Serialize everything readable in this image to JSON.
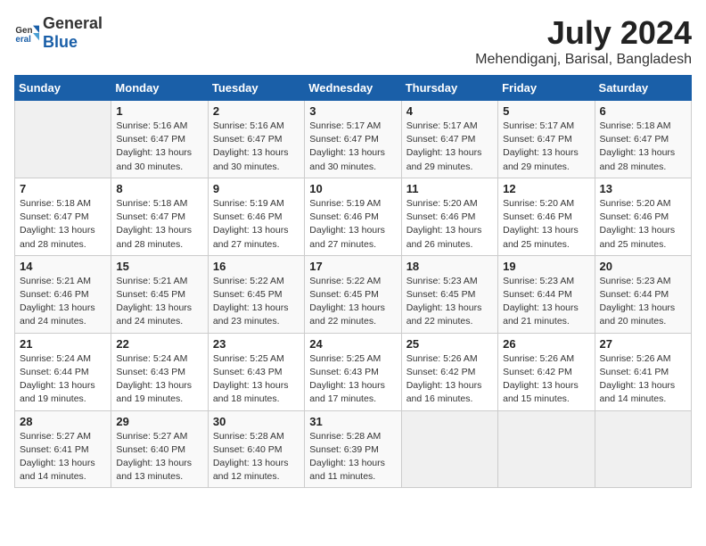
{
  "header": {
    "logo_general": "General",
    "logo_blue": "Blue",
    "title": "July 2024",
    "subtitle": "Mehendiganj, Barisal, Bangladesh"
  },
  "days_of_week": [
    "Sunday",
    "Monday",
    "Tuesday",
    "Wednesday",
    "Thursday",
    "Friday",
    "Saturday"
  ],
  "weeks": [
    [
      {
        "day": "",
        "info": ""
      },
      {
        "day": "1",
        "info": "Sunrise: 5:16 AM\nSunset: 6:47 PM\nDaylight: 13 hours\nand 30 minutes."
      },
      {
        "day": "2",
        "info": "Sunrise: 5:16 AM\nSunset: 6:47 PM\nDaylight: 13 hours\nand 30 minutes."
      },
      {
        "day": "3",
        "info": "Sunrise: 5:17 AM\nSunset: 6:47 PM\nDaylight: 13 hours\nand 30 minutes."
      },
      {
        "day": "4",
        "info": "Sunrise: 5:17 AM\nSunset: 6:47 PM\nDaylight: 13 hours\nand 29 minutes."
      },
      {
        "day": "5",
        "info": "Sunrise: 5:17 AM\nSunset: 6:47 PM\nDaylight: 13 hours\nand 29 minutes."
      },
      {
        "day": "6",
        "info": "Sunrise: 5:18 AM\nSunset: 6:47 PM\nDaylight: 13 hours\nand 28 minutes."
      }
    ],
    [
      {
        "day": "7",
        "info": "Sunrise: 5:18 AM\nSunset: 6:47 PM\nDaylight: 13 hours\nand 28 minutes."
      },
      {
        "day": "8",
        "info": "Sunrise: 5:18 AM\nSunset: 6:47 PM\nDaylight: 13 hours\nand 28 minutes."
      },
      {
        "day": "9",
        "info": "Sunrise: 5:19 AM\nSunset: 6:46 PM\nDaylight: 13 hours\nand 27 minutes."
      },
      {
        "day": "10",
        "info": "Sunrise: 5:19 AM\nSunset: 6:46 PM\nDaylight: 13 hours\nand 27 minutes."
      },
      {
        "day": "11",
        "info": "Sunrise: 5:20 AM\nSunset: 6:46 PM\nDaylight: 13 hours\nand 26 minutes."
      },
      {
        "day": "12",
        "info": "Sunrise: 5:20 AM\nSunset: 6:46 PM\nDaylight: 13 hours\nand 25 minutes."
      },
      {
        "day": "13",
        "info": "Sunrise: 5:20 AM\nSunset: 6:46 PM\nDaylight: 13 hours\nand 25 minutes."
      }
    ],
    [
      {
        "day": "14",
        "info": "Sunrise: 5:21 AM\nSunset: 6:46 PM\nDaylight: 13 hours\nand 24 minutes."
      },
      {
        "day": "15",
        "info": "Sunrise: 5:21 AM\nSunset: 6:45 PM\nDaylight: 13 hours\nand 24 minutes."
      },
      {
        "day": "16",
        "info": "Sunrise: 5:22 AM\nSunset: 6:45 PM\nDaylight: 13 hours\nand 23 minutes."
      },
      {
        "day": "17",
        "info": "Sunrise: 5:22 AM\nSunset: 6:45 PM\nDaylight: 13 hours\nand 22 minutes."
      },
      {
        "day": "18",
        "info": "Sunrise: 5:23 AM\nSunset: 6:45 PM\nDaylight: 13 hours\nand 22 minutes."
      },
      {
        "day": "19",
        "info": "Sunrise: 5:23 AM\nSunset: 6:44 PM\nDaylight: 13 hours\nand 21 minutes."
      },
      {
        "day": "20",
        "info": "Sunrise: 5:23 AM\nSunset: 6:44 PM\nDaylight: 13 hours\nand 20 minutes."
      }
    ],
    [
      {
        "day": "21",
        "info": "Sunrise: 5:24 AM\nSunset: 6:44 PM\nDaylight: 13 hours\nand 19 minutes."
      },
      {
        "day": "22",
        "info": "Sunrise: 5:24 AM\nSunset: 6:43 PM\nDaylight: 13 hours\nand 19 minutes."
      },
      {
        "day": "23",
        "info": "Sunrise: 5:25 AM\nSunset: 6:43 PM\nDaylight: 13 hours\nand 18 minutes."
      },
      {
        "day": "24",
        "info": "Sunrise: 5:25 AM\nSunset: 6:43 PM\nDaylight: 13 hours\nand 17 minutes."
      },
      {
        "day": "25",
        "info": "Sunrise: 5:26 AM\nSunset: 6:42 PM\nDaylight: 13 hours\nand 16 minutes."
      },
      {
        "day": "26",
        "info": "Sunrise: 5:26 AM\nSunset: 6:42 PM\nDaylight: 13 hours\nand 15 minutes."
      },
      {
        "day": "27",
        "info": "Sunrise: 5:26 AM\nSunset: 6:41 PM\nDaylight: 13 hours\nand 14 minutes."
      }
    ],
    [
      {
        "day": "28",
        "info": "Sunrise: 5:27 AM\nSunset: 6:41 PM\nDaylight: 13 hours\nand 14 minutes."
      },
      {
        "day": "29",
        "info": "Sunrise: 5:27 AM\nSunset: 6:40 PM\nDaylight: 13 hours\nand 13 minutes."
      },
      {
        "day": "30",
        "info": "Sunrise: 5:28 AM\nSunset: 6:40 PM\nDaylight: 13 hours\nand 12 minutes."
      },
      {
        "day": "31",
        "info": "Sunrise: 5:28 AM\nSunset: 6:39 PM\nDaylight: 13 hours\nand 11 minutes."
      },
      {
        "day": "",
        "info": ""
      },
      {
        "day": "",
        "info": ""
      },
      {
        "day": "",
        "info": ""
      }
    ]
  ]
}
